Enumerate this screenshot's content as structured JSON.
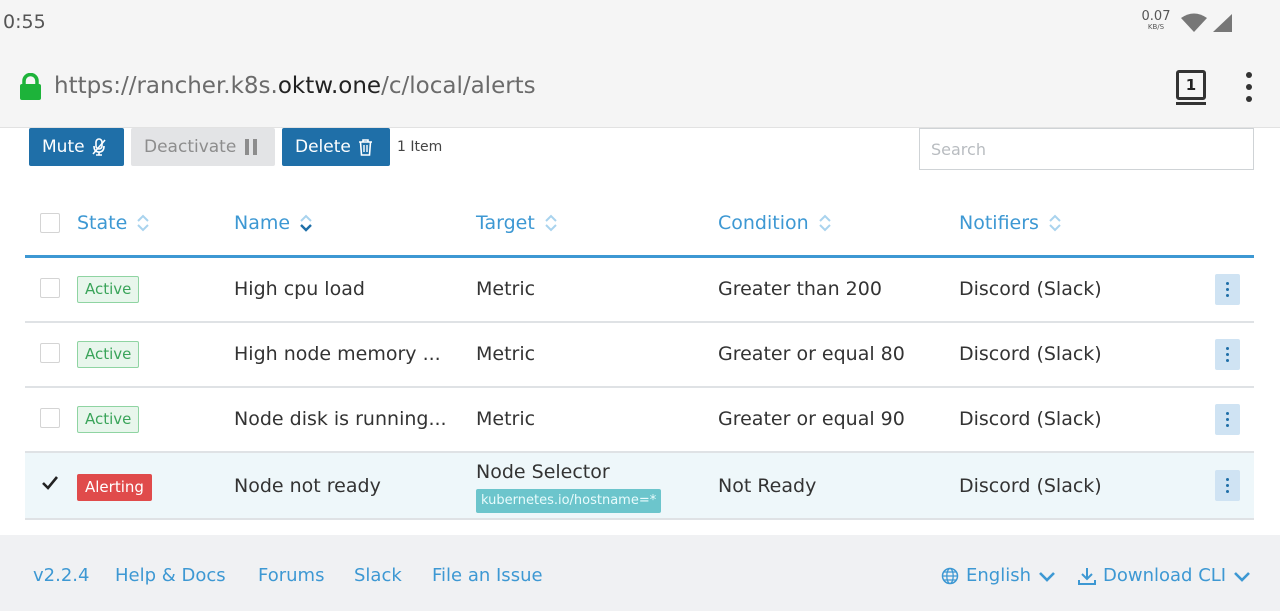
{
  "status_bar": {
    "time": "0:55",
    "net_speed_value": "0.07",
    "net_speed_unit": "KB/S",
    "wifi_icon": "wifi-icon",
    "signal_icon": "cell-signal-icon"
  },
  "browser": {
    "url_prefix": "https://rancher.k8s.",
    "url_host": "oktw.one",
    "url_path": "/c/local/alerts",
    "tab_count": "1",
    "lock_color": "#1db33a"
  },
  "toolbar": {
    "mute_label": "Mute",
    "deactivate_label": "Deactivate",
    "delete_label": "Delete",
    "item_count": "1 Item",
    "search_placeholder": "Search"
  },
  "table": {
    "columns": [
      "State",
      "Name",
      "Target",
      "Condition",
      "Notifiers"
    ],
    "rows": [
      {
        "checked": false,
        "state": "Active",
        "name": "High cpu load",
        "target": "Metric",
        "condition": "Greater than 200",
        "notifiers": "Discord (Slack)"
      },
      {
        "checked": false,
        "state": "Active",
        "name": "High node memory ...",
        "target": "Metric",
        "condition": "Greater or equal 80",
        "notifiers": "Discord (Slack)"
      },
      {
        "checked": false,
        "state": "Active",
        "name": "Node disk is running...",
        "target": "Metric",
        "condition": "Greater or equal 90",
        "notifiers": "Discord (Slack)"
      },
      {
        "checked": true,
        "state": "Alerting",
        "name": "Node not ready",
        "target": "Node Selector",
        "target_tag": "kubernetes.io/hostname=*",
        "condition": "Not Ready",
        "notifiers": "Discord (Slack)"
      }
    ]
  },
  "footer": {
    "version": "v2.2.4",
    "help_docs": "Help & Docs",
    "forums": "Forums",
    "slack": "Slack",
    "file_issue": "File an Issue",
    "language": "English",
    "download_cli": "Download CLI"
  },
  "colors": {
    "primary": "#1f6fa8",
    "link": "#3d98d3",
    "active": "#3aa45a",
    "alerting": "#e04b4b",
    "tag": "#6cc5cc"
  }
}
